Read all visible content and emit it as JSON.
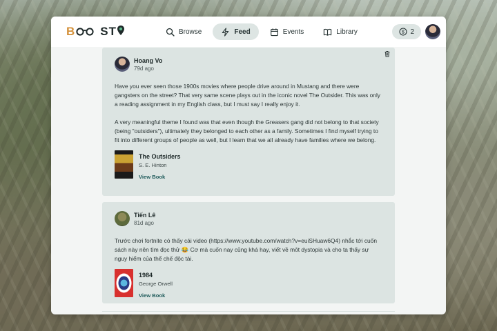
{
  "app": {
    "logo_parts": {
      "b": "B",
      "stp": "ST",
      "p": "P"
    },
    "nav": [
      {
        "label": "Browse",
        "icon": "search-icon",
        "active": false
      },
      {
        "label": "Feed",
        "icon": "lightning-icon",
        "active": true
      },
      {
        "label": "Events",
        "icon": "calendar-icon",
        "active": false
      },
      {
        "label": "Library",
        "icon": "book-icon",
        "active": false
      }
    ],
    "credits": "2"
  },
  "posts": [
    {
      "author": "Hoang Vo",
      "time": "79d ago",
      "paragraphs": [
        "Have you ever seen those 1900s movies where people drive around in Mustang and there were gangsters on the street? That very same scene plays out in the iconic novel The Outsider. This was only a reading assignment in my English class, but I must say I really enjoy it.",
        "A very meaningful theme I found was that even though the Greasers gang did not belong to that society (being \"outsiders\"), ultimately they belonged to each other as a family. Sometimes I find myself trying to fit into different groups of people as well, but I learn that we all already have families where we belong."
      ],
      "book": {
        "title": "The Outsiders",
        "author": "S. E. Hinton",
        "link": "View Book"
      }
    },
    {
      "author": "Tiến Lê",
      "time": "81d ago",
      "paragraphs": [
        "Trước chơi fortnite có thấy cái video (https://www.youtube.com/watch?v=euiSHuaw6Q4) nhắc tới cuốn sách này nên tìm đọc thử 😂 Cơ mà cuốn nay cũng khá hay, viết về môt dystopia và cho ta thấy sự nguy hiểm của thể chế độc tài."
      ],
      "book": {
        "title": "1984",
        "author": "George Orwell",
        "link": "View Book"
      }
    }
  ],
  "colors": {
    "accent": "#d4913a",
    "card": "#dce4e2",
    "link": "#1f5b5b"
  }
}
